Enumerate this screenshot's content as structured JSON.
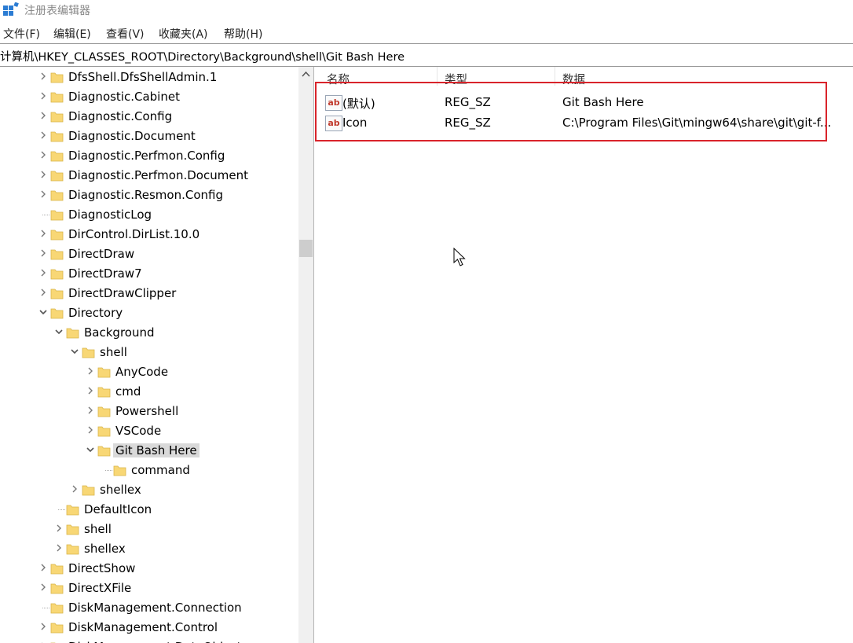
{
  "window": {
    "title": "注册表编辑器",
    "icon": "regedit-icon"
  },
  "menu": [
    "文件(F)",
    "编辑(E)",
    "查看(V)",
    "收藏夹(A)",
    "帮助(H)"
  ],
  "address": "计算机\\HKEY_CLASSES_ROOT\\Directory\\Background\\shell\\Git Bash Here",
  "tree": [
    {
      "label": "DfsShell.DfsShellAdmin.1",
      "depth": 0,
      "state": "collapsed"
    },
    {
      "label": "Diagnostic.Cabinet",
      "depth": 0,
      "state": "collapsed"
    },
    {
      "label": "Diagnostic.Config",
      "depth": 0,
      "state": "collapsed"
    },
    {
      "label": "Diagnostic.Document",
      "depth": 0,
      "state": "collapsed"
    },
    {
      "label": "Diagnostic.Perfmon.Config",
      "depth": 0,
      "state": "collapsed"
    },
    {
      "label": "Diagnostic.Perfmon.Document",
      "depth": 0,
      "state": "collapsed"
    },
    {
      "label": "Diagnostic.Resmon.Config",
      "depth": 0,
      "state": "collapsed"
    },
    {
      "label": "DiagnosticLog",
      "depth": 0,
      "state": "leaf"
    },
    {
      "label": "DirControl.DirList.10.0",
      "depth": 0,
      "state": "collapsed"
    },
    {
      "label": "DirectDraw",
      "depth": 0,
      "state": "collapsed"
    },
    {
      "label": "DirectDraw7",
      "depth": 0,
      "state": "collapsed"
    },
    {
      "label": "DirectDrawClipper",
      "depth": 0,
      "state": "collapsed"
    },
    {
      "label": "Directory",
      "depth": 0,
      "state": "expanded"
    },
    {
      "label": "Background",
      "depth": 1,
      "state": "expanded"
    },
    {
      "label": "shell",
      "depth": 2,
      "state": "expanded"
    },
    {
      "label": "AnyCode",
      "depth": 3,
      "state": "collapsed"
    },
    {
      "label": "cmd",
      "depth": 3,
      "state": "collapsed"
    },
    {
      "label": "Powershell",
      "depth": 3,
      "state": "collapsed"
    },
    {
      "label": "VSCode",
      "depth": 3,
      "state": "collapsed"
    },
    {
      "label": "Git Bash Here",
      "depth": 3,
      "state": "expanded",
      "selected": true
    },
    {
      "label": "command",
      "depth": 4,
      "state": "leaf"
    },
    {
      "label": "shellex",
      "depth": 2,
      "state": "collapsed"
    },
    {
      "label": "DefaultIcon",
      "depth": 1,
      "state": "leaf"
    },
    {
      "label": "shell",
      "depth": 1,
      "state": "collapsed"
    },
    {
      "label": "shellex",
      "depth": 1,
      "state": "collapsed"
    },
    {
      "label": "DirectShow",
      "depth": 0,
      "state": "collapsed"
    },
    {
      "label": "DirectXFile",
      "depth": 0,
      "state": "collapsed"
    },
    {
      "label": "DiskManagement.Connection",
      "depth": 0,
      "state": "leaf"
    },
    {
      "label": "DiskManagement.Control",
      "depth": 0,
      "state": "collapsed"
    },
    {
      "label": "DiskManagement.DataObject",
      "depth": 0,
      "state": "collapsed"
    }
  ],
  "list": {
    "columns": [
      "名称",
      "类型",
      "数据"
    ],
    "rows": [
      {
        "name": "(默认)",
        "type": "REG_SZ",
        "data": "Git Bash Here"
      },
      {
        "name": "Icon",
        "type": "REG_SZ",
        "data": "C:\\Program Files\\Git\\mingw64\\share\\git\\git-f..."
      }
    ],
    "icon_text": "ab"
  },
  "colors": {
    "highlight_box": "#d9242b",
    "folder": "#f8d775",
    "selection": "#d9d9d9"
  }
}
